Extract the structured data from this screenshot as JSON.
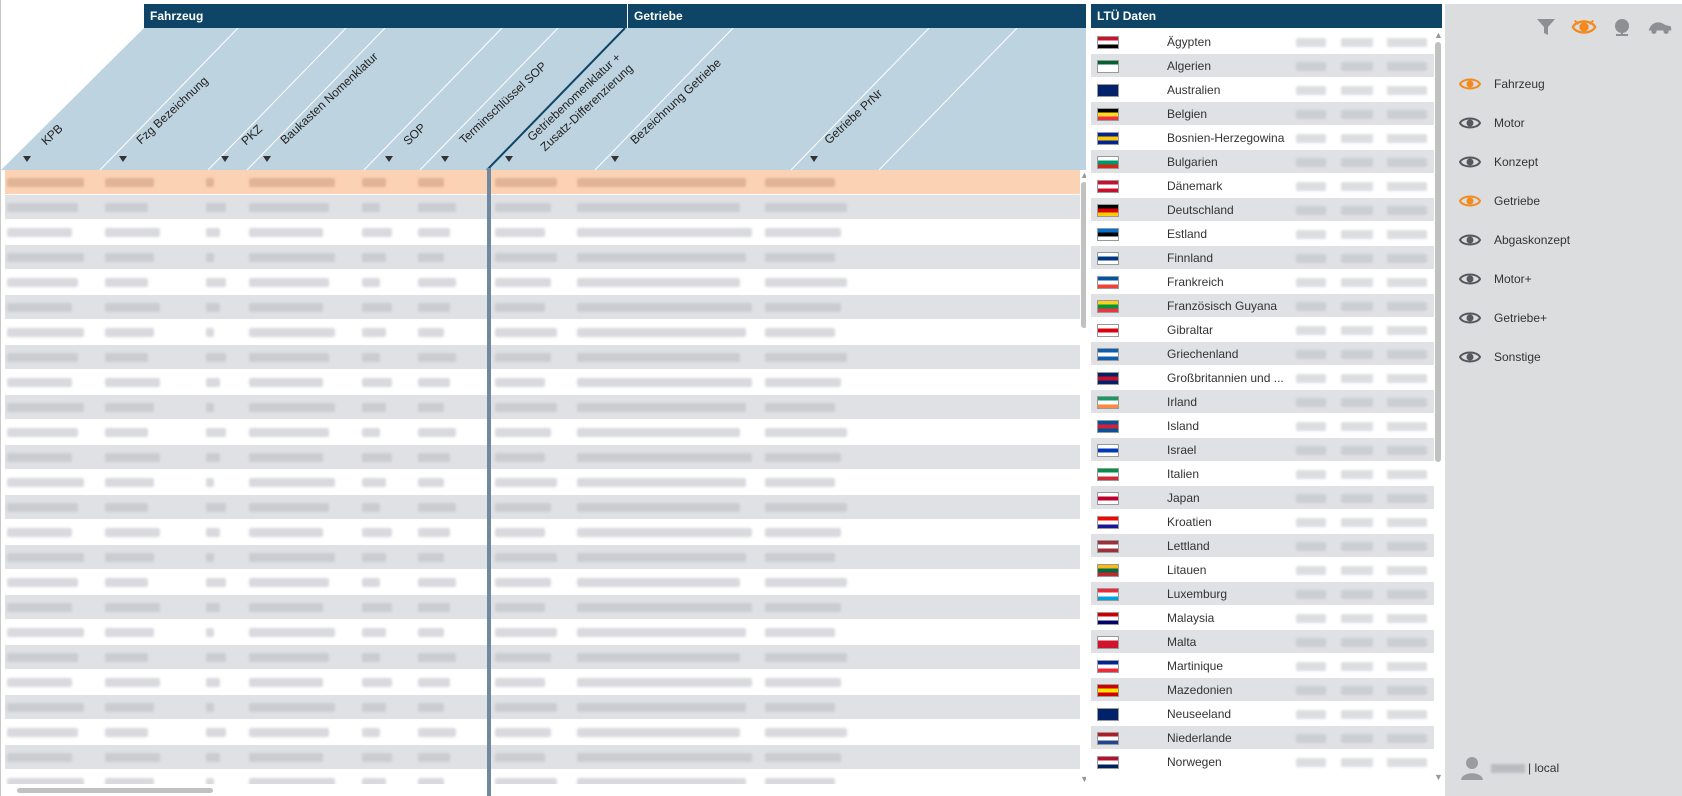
{
  "groups": {
    "fahrzeug": "Fahrzeug",
    "getriebe": "Getriebe"
  },
  "columns": [
    "KPB",
    "Fzg Bezeichnung",
    "PKZ",
    "Baukasten Nomenklatur",
    "SOP",
    "Terminschlüssel SOP",
    "Getriebenomenklatur +",
    "Zusatz-Differenzierung",
    "Bezeichnung Getriebe",
    "Getriebe PrNr"
  ],
  "ltu": {
    "title": "LTÜ Daten",
    "countries": [
      "Ägypten",
      "Algerien",
      "Australien",
      "Belgien",
      "Bosnien-Herzegowina",
      "Bulgarien",
      "Dänemark",
      "Deutschland",
      "Estland",
      "Finnland",
      "Frankreich",
      "Französisch Guyana",
      "Gibraltar",
      "Griechenland",
      "Großbritannien und ...",
      "Irland",
      "Island",
      "Israel",
      "Italien",
      "Japan",
      "Kroatien",
      "Lettland",
      "Litauen",
      "Luxemburg",
      "Malaysia",
      "Malta",
      "Martinique",
      "Mazedonien",
      "Neuseeland",
      "Niederlande",
      "Norwegen"
    ]
  },
  "sidebar": {
    "tools": [
      "filter-icon",
      "eye-icon",
      "globe-icon",
      "car-icon"
    ],
    "items": [
      {
        "label": "Fahrzeug",
        "active": true
      },
      {
        "label": "Motor",
        "active": false
      },
      {
        "label": "Konzept",
        "active": false
      },
      {
        "label": "Getriebe",
        "active": true
      },
      {
        "label": "Abgaskonzept",
        "active": false
      },
      {
        "label": "Motor+",
        "active": false
      },
      {
        "label": "Getriebe+",
        "active": false
      },
      {
        "label": "Sonstige",
        "active": false
      }
    ],
    "user_suffix": "| local"
  },
  "colors": {
    "header": "#0e4466",
    "head_bg": "#bed3e0",
    "accent": "#f28a1e",
    "selected_row": "#fbd3b4"
  }
}
